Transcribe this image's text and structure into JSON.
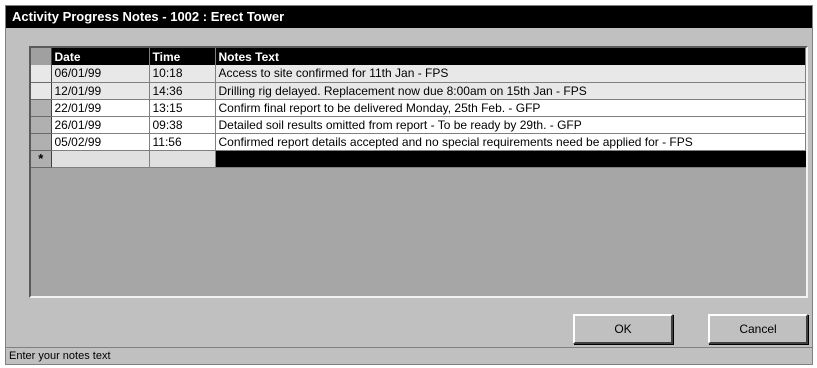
{
  "window": {
    "title": "Activity Progress Notes - 1002 : Erect Tower"
  },
  "grid": {
    "columns": [
      "Date",
      "Time",
      "Notes Text"
    ],
    "rows": [
      {
        "date": "06/01/99",
        "time": "10:18",
        "notes": "Access to site confirmed for 11th Jan - FPS"
      },
      {
        "date": "12/01/99",
        "time": "14:36",
        "notes": "Drilling rig delayed.  Replacement now due 8:00am on 15th Jan - FPS"
      },
      {
        "date": "22/01/99",
        "time": "13:15",
        "notes": "Confirm final report to be delivered Monday, 25th Feb. - GFP"
      },
      {
        "date": "26/01/99",
        "time": "09:38",
        "notes": "Detailed soil results omitted from report - To be ready by 29th. - GFP"
      },
      {
        "date": "05/02/99",
        "time": "11:56",
        "notes": "Confirmed report details accepted and no special requirements need be applied for - FPS"
      }
    ],
    "new_row_marker": "*"
  },
  "buttons": {
    "ok": "OK",
    "cancel": "Cancel"
  },
  "status": {
    "text": "Enter your notes text"
  }
}
